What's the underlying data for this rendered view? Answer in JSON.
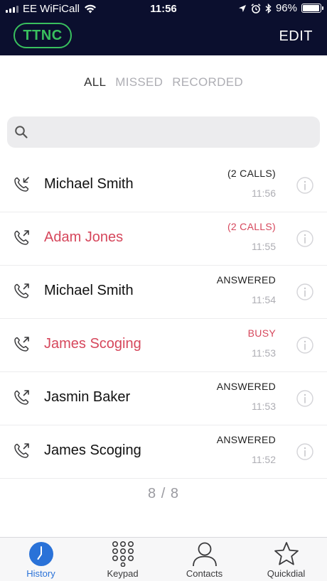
{
  "status_bar": {
    "carrier": "EE WiFiCall",
    "time": "11:56",
    "battery": "96%",
    "battery_level": 0.96
  },
  "nav": {
    "brand": "TTNC",
    "edit_label": "EDIT"
  },
  "filters": {
    "all": "ALL",
    "missed": "MISSED",
    "recorded": "RECORDED",
    "active": "all"
  },
  "search": {
    "placeholder": ""
  },
  "calls": [
    {
      "name": "Michael Smith",
      "status": "(2 CALLS)",
      "time": "11:56",
      "direction": "incoming",
      "missed": false
    },
    {
      "name": "Adam Jones",
      "status": "(2 CALLS)",
      "time": "11:55",
      "direction": "outgoing",
      "missed": true
    },
    {
      "name": "Michael Smith",
      "status": "ANSWERED",
      "time": "11:54",
      "direction": "outgoing",
      "missed": false
    },
    {
      "name": "James Scoging",
      "status": "BUSY",
      "time": "11:53",
      "direction": "outgoing",
      "missed": true
    },
    {
      "name": "Jasmin Baker",
      "status": "ANSWERED",
      "time": "11:53",
      "direction": "outgoing",
      "missed": false
    },
    {
      "name": "James Scoging",
      "status": "ANSWERED",
      "time": "11:52",
      "direction": "outgoing",
      "missed": false
    }
  ],
  "pager": "8 / 8",
  "tabs": [
    {
      "label": "History",
      "icon": "clock-icon",
      "active": true
    },
    {
      "label": "Keypad",
      "icon": "keypad-icon",
      "active": false
    },
    {
      "label": "Contacts",
      "icon": "person-icon",
      "active": false
    },
    {
      "label": "Quickdial",
      "icon": "star-icon",
      "active": false
    }
  ],
  "colors": {
    "header_bg": "#0b0f2e",
    "brand_green": "#39c05e",
    "missed_red": "#d6475c",
    "active_blue": "#2a72d8"
  }
}
